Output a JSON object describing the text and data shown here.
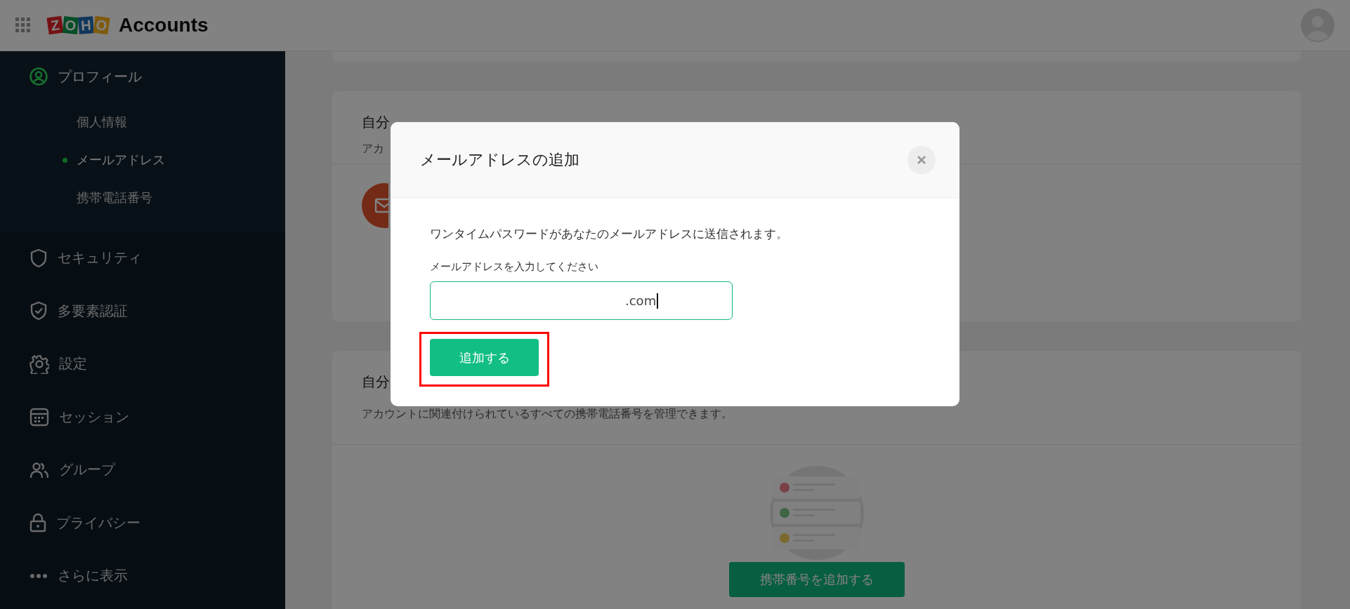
{
  "header": {
    "logo_letters": "ZOHO",
    "app_name": "Accounts"
  },
  "sidebar": {
    "items": [
      {
        "label": "プロフィール",
        "kind": "profile",
        "selected": true,
        "children": [
          {
            "label": "個人情報",
            "selected": false
          },
          {
            "label": "メールアドレス",
            "selected": true
          },
          {
            "label": "携帯電話番号",
            "selected": false
          }
        ]
      },
      {
        "label": "セキュリティ",
        "kind": "shield",
        "selected": false
      },
      {
        "label": "多要素認証",
        "kind": "shield-check",
        "selected": false
      },
      {
        "label": "設定",
        "kind": "gear",
        "selected": false
      },
      {
        "label": "セッション",
        "kind": "calendar",
        "selected": false
      },
      {
        "label": "グループ",
        "kind": "people",
        "selected": false
      },
      {
        "label": "プライバシー",
        "kind": "lock",
        "selected": false
      },
      {
        "label": "さらに表示",
        "kind": "more",
        "selected": false
      }
    ]
  },
  "cards": [
    {
      "title": "自分",
      "subtitle": "アカ",
      "kind": "email"
    },
    {
      "title": "自分",
      "subtitle": "アカウントに関連付けられているすべての携帯電話番号を管理できます。",
      "kind": "phone",
      "button": "携帯番号を追加する"
    }
  ],
  "dialog": {
    "title": "メールアドレスの追加",
    "message": "ワンタイムパスワードがあなたのメールアドレスに送信されます。",
    "field_label": "メールアドレスを入力してください",
    "field_value": ".com",
    "button": "追加する"
  }
}
